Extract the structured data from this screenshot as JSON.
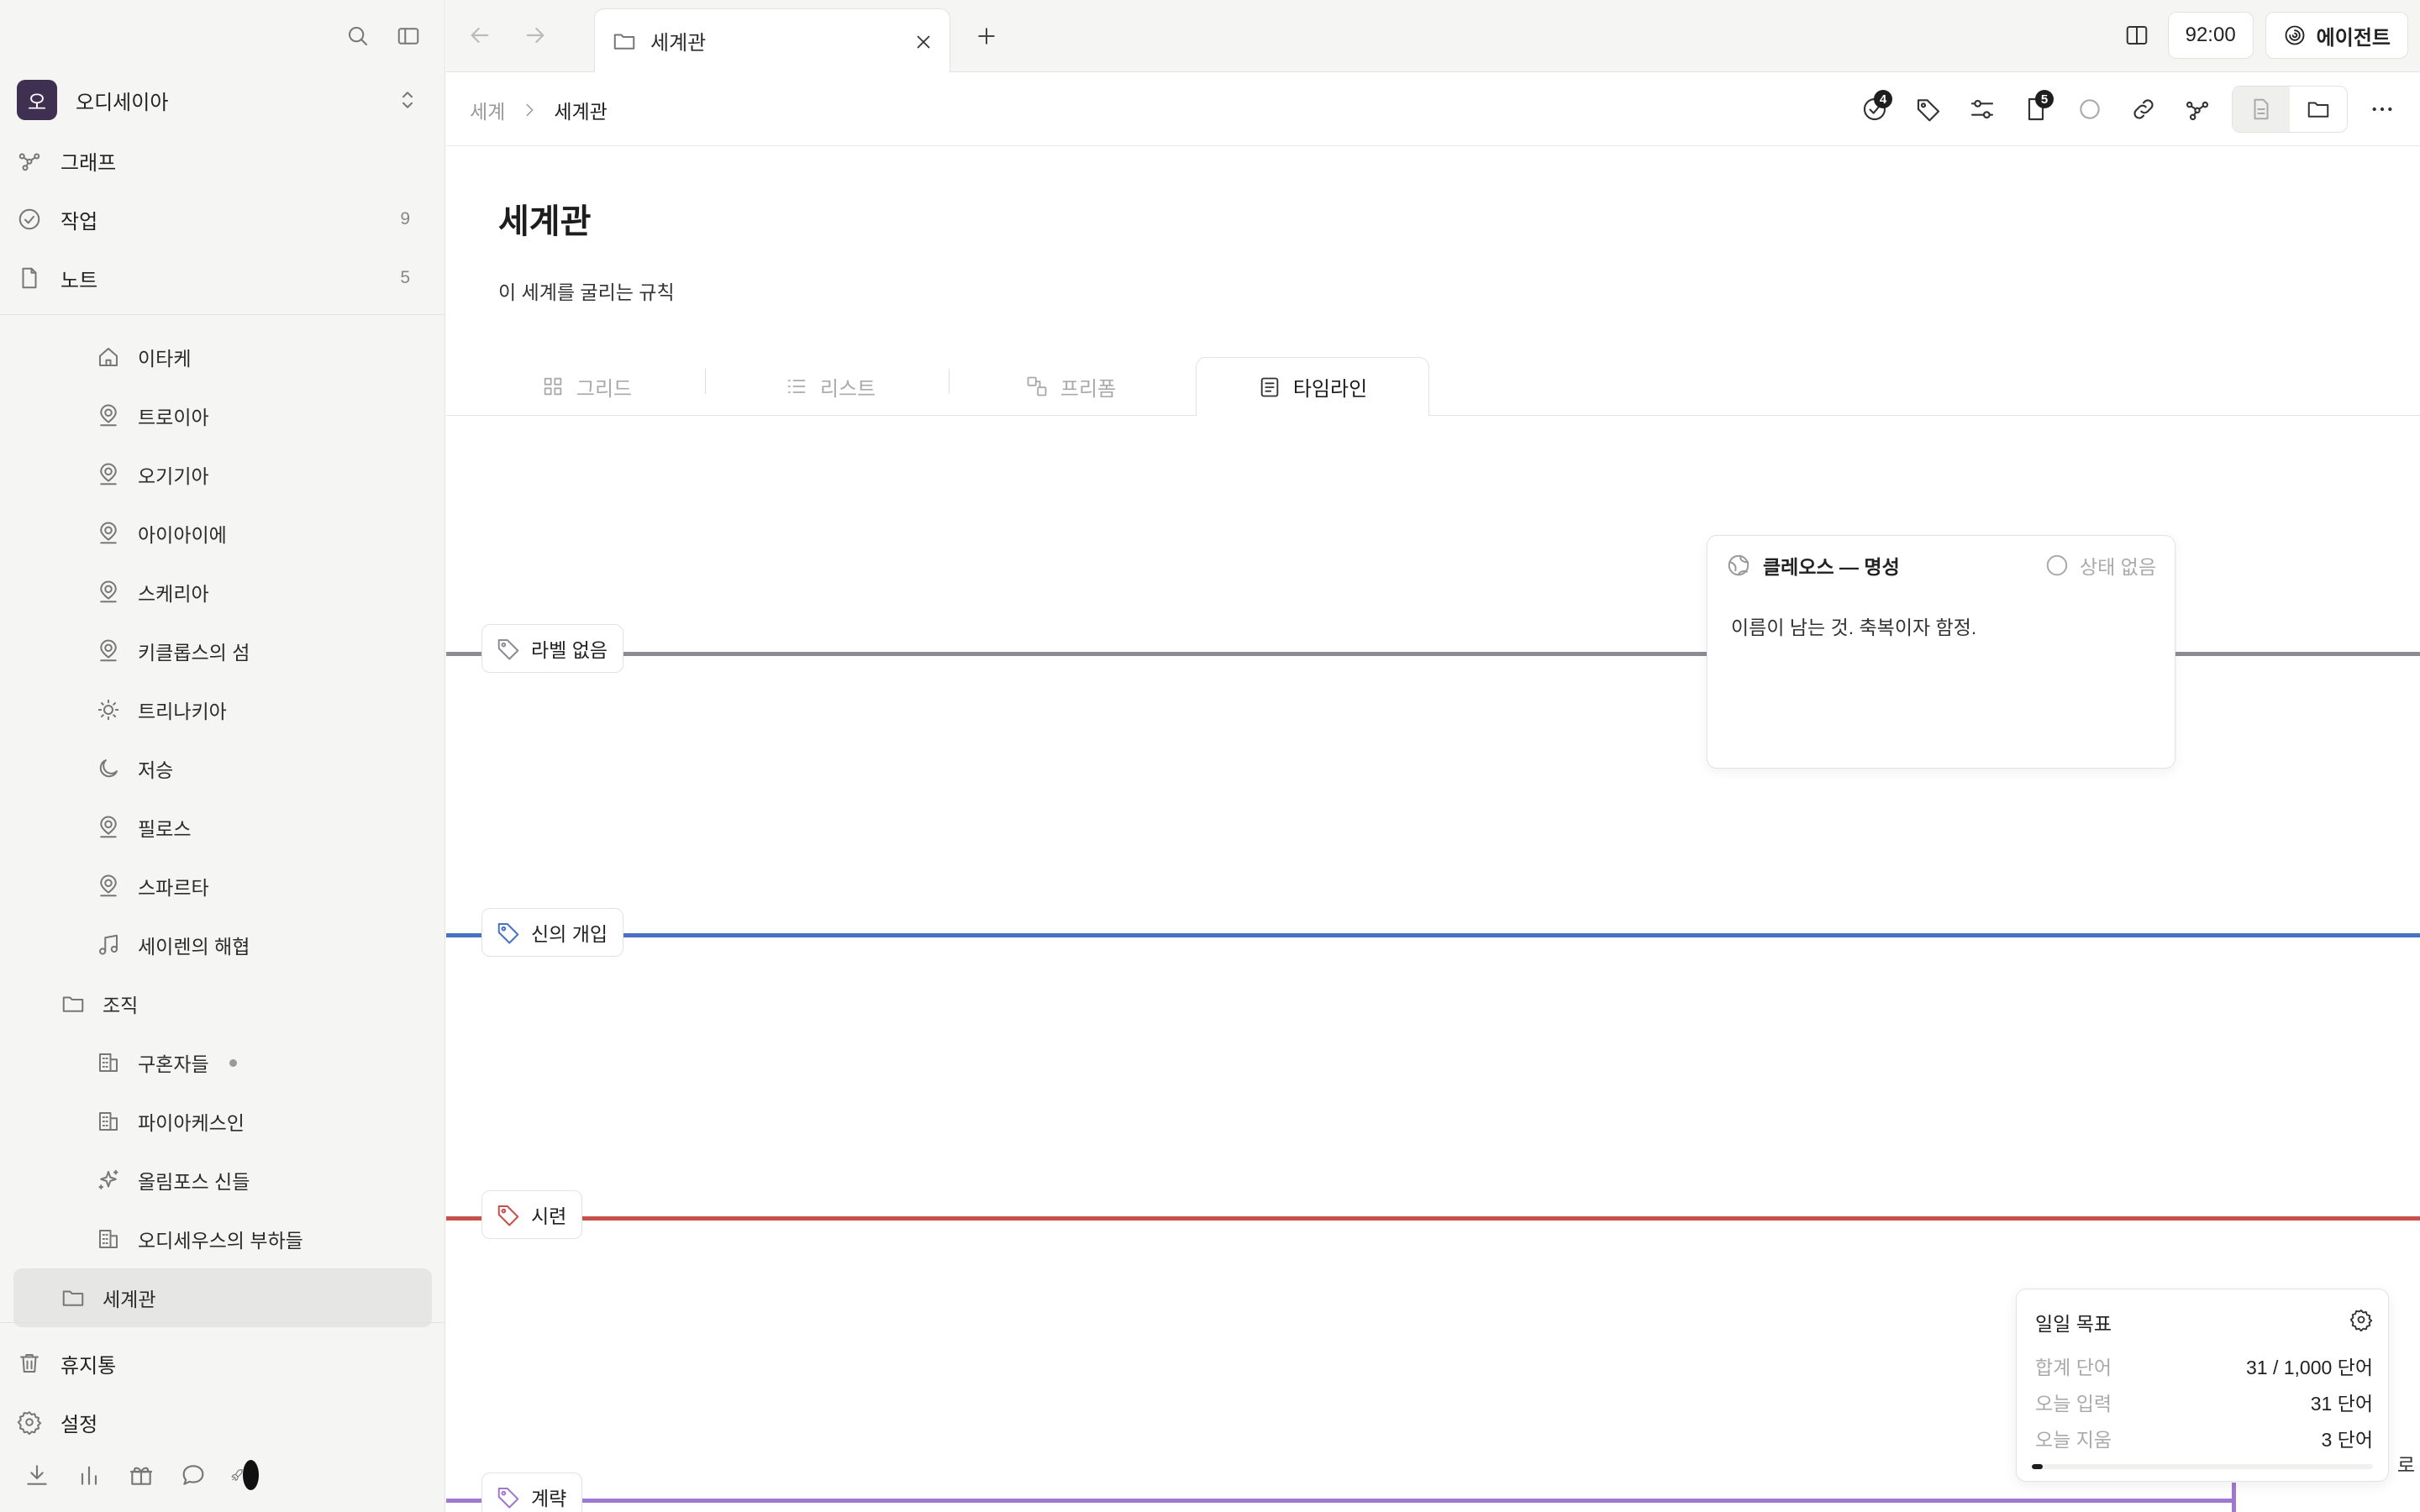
{
  "sidebar": {
    "workspace": {
      "initial": "오",
      "name": "오디세이아"
    },
    "nav": [
      {
        "label": "그래프",
        "count": ""
      },
      {
        "label": "작업",
        "count": "9"
      },
      {
        "label": "노트",
        "count": "5"
      }
    ],
    "tree": [
      {
        "label": "이타케",
        "icon": "home-icon"
      },
      {
        "label": "트로이아",
        "icon": "location-icon"
      },
      {
        "label": "오기기아",
        "icon": "location-icon"
      },
      {
        "label": "아이아이에",
        "icon": "location-icon"
      },
      {
        "label": "스케리아",
        "icon": "location-icon"
      },
      {
        "label": "키클롭스의 섬",
        "icon": "location-icon"
      },
      {
        "label": "트리나키아",
        "icon": "sun-icon"
      },
      {
        "label": "저승",
        "icon": "moon-icon"
      },
      {
        "label": "필로스",
        "icon": "location-icon"
      },
      {
        "label": "스파르타",
        "icon": "location-icon"
      },
      {
        "label": "세이렌의 해협",
        "icon": "music-icon"
      },
      {
        "label": "조직",
        "icon": "folder-icon"
      },
      {
        "label": "구혼자들",
        "icon": "building-icon"
      },
      {
        "label": "파이아케스인",
        "icon": "building-icon"
      },
      {
        "label": "올림포스 신들",
        "icon": "sparkle-icon"
      },
      {
        "label": "오디세우스의 부하들",
        "icon": "building-icon"
      },
      {
        "label": "세계관",
        "icon": "folder-icon"
      }
    ],
    "bottom": [
      {
        "label": "휴지통"
      },
      {
        "label": "설정"
      }
    ]
  },
  "topbar": {
    "tab_title": "세계관",
    "timer": "92:00",
    "agent_label": "에이전트"
  },
  "breadcrumb": {
    "parent": "세계",
    "current": "세계관"
  },
  "toolbar": {
    "tasks_badge": "4",
    "notes_badge": "5"
  },
  "page": {
    "title": "세계관",
    "description": "이 세계를 굴리는 규칙",
    "view_tabs": [
      {
        "label": "그리드"
      },
      {
        "label": "리스트"
      },
      {
        "label": "프리폼"
      },
      {
        "label": "타임라인"
      }
    ],
    "active_view": "타임라인"
  },
  "timeline": {
    "lanes": [
      {
        "label": "라벨 없음",
        "color": "#8e8c93"
      },
      {
        "label": "신의 개입",
        "color": "#4a72c4"
      },
      {
        "label": "시련",
        "color": "#c8504b"
      },
      {
        "label": "계략",
        "color": "#a078cf"
      }
    ],
    "card": {
      "title": "클레오스 — 명성",
      "status": "상태 없음",
      "body": "이름이 남는 것. 축복이자 함정."
    }
  },
  "daily_goal": {
    "title": "일일 목표",
    "rows": [
      {
        "key": "합계 단어",
        "value": "31 / 1,000 단어"
      },
      {
        "key": "오늘 입력",
        "value": "31 단어"
      },
      {
        "key": "오늘 지움",
        "value": "3 단어"
      }
    ],
    "progress": 0.031
  },
  "edge_text": "로"
}
